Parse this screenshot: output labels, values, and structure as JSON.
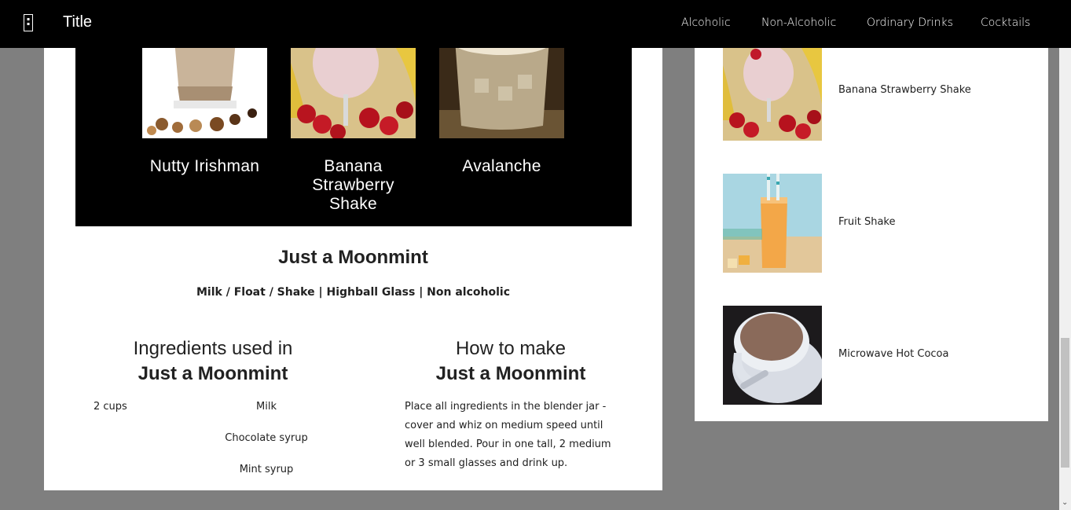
{
  "navbar": {
    "brand": "Title",
    "links": [
      "Alcoholic",
      "Non-Alcoholic",
      "Ordinary Drinks",
      "Cocktails"
    ]
  },
  "carousel": {
    "items": [
      {
        "caption": "Nutty Irishman",
        "image": "nutty-irishman-photo"
      },
      {
        "caption": "Banana Strawberry Shake",
        "image": "banana-strawberry-shake-photo"
      },
      {
        "caption": "Avalanche",
        "image": "avalanche-photo"
      }
    ]
  },
  "drink": {
    "title": "Just a Moonmint",
    "meta": "Milk / Float / Shake | Highball Glass | Non alcoholic",
    "ingredients_heading": "Ingredients used in",
    "how_heading": "How to make",
    "ingredients": [
      {
        "qty": "2 cups",
        "name": "Milk"
      },
      {
        "qty": "",
        "name": "Chocolate syrup"
      },
      {
        "qty": "",
        "name": "Mint syrup"
      }
    ],
    "instructions": "Place all ingredients in the blender jar - cover and whiz on medium speed until well blended. Pour in one tall, 2 medium or 3 small glasses and drink up."
  },
  "sidebar": {
    "items": [
      {
        "label": "Banana Strawberry Shake",
        "image": "banana-strawberry-shake-photo"
      },
      {
        "label": "Fruit Shake",
        "image": "fruit-shake-photo"
      },
      {
        "label": "Microwave Hot Cocoa",
        "image": "microwave-hot-cocoa-photo"
      }
    ]
  },
  "colors": {
    "navbar": "#000000",
    "page_background": "#7f7f7f",
    "card": "#ffffff",
    "carousel": "#000000"
  }
}
